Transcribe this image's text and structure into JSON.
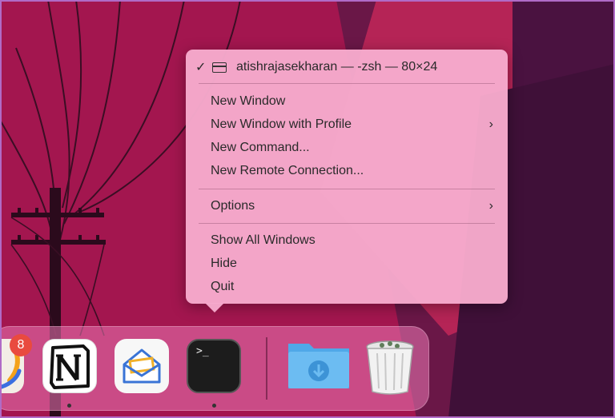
{
  "context_menu": {
    "window_item": "atishrajasekharan — -zsh — 80×24",
    "items": [
      {
        "label": "New Window"
      },
      {
        "label": "New Window with Profile"
      },
      {
        "label": "New Command..."
      },
      {
        "label": "New Remote Connection..."
      },
      {
        "label": "Options"
      },
      {
        "label": "Show All Windows"
      },
      {
        "label": "Hide"
      },
      {
        "label": "Quit"
      }
    ]
  },
  "dock": {
    "badge_count": "8",
    "apps": [
      {
        "name": "partial-app-icon"
      },
      {
        "name": "notion-icon",
        "glyph": "N"
      },
      {
        "name": "mail-envelope-icon"
      },
      {
        "name": "terminal-icon",
        "glyph": ">_"
      },
      {
        "name": "downloads-folder-icon"
      },
      {
        "name": "trash-icon"
      }
    ]
  },
  "colors": {
    "menu_bg": "#f6aacc",
    "dock_bg": "#eb78b4",
    "desktop_bg": "#8a1a4a",
    "badge": "#e94a3f"
  }
}
